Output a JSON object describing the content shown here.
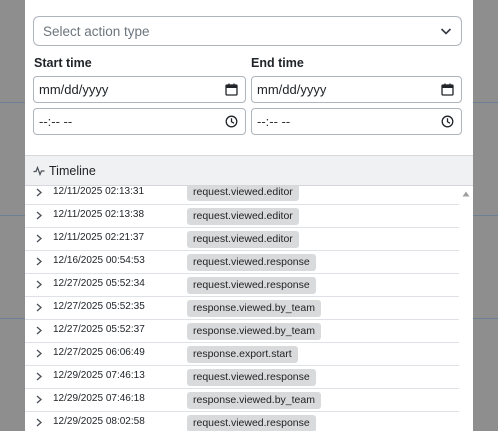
{
  "modal": {
    "action_select": {
      "placeholder": "Select action type"
    },
    "start_label": "Start time",
    "end_label": "End time",
    "start_date_placeholder": "mm/dd/yyyy",
    "end_date_placeholder": "mm/dd/yyyy",
    "start_time_placeholder": "--:-- --",
    "end_time_placeholder": "--:-- --",
    "timeline_title": "Timeline",
    "events": [
      {
        "time": "12/11/2025 02:13:31",
        "action": "request.viewed.editor"
      },
      {
        "time": "12/11/2025 02:13:38",
        "action": "request.viewed.editor"
      },
      {
        "time": "12/11/2025 02:21:37",
        "action": "request.viewed.editor"
      },
      {
        "time": "12/16/2025 00:54:53",
        "action": "request.viewed.response"
      },
      {
        "time": "12/27/2025 05:52:34",
        "action": "request.viewed.response"
      },
      {
        "time": "12/27/2025 05:52:35",
        "action": "response.viewed.by_team"
      },
      {
        "time": "12/27/2025 05:52:37",
        "action": "response.viewed.by_team"
      },
      {
        "time": "12/27/2025 06:06:49",
        "action": "response.export.start"
      },
      {
        "time": "12/29/2025 07:46:13",
        "action": "request.viewed.response"
      },
      {
        "time": "12/29/2025 07:46:18",
        "action": "response.viewed.by_team"
      },
      {
        "time": "12/29/2025 08:02:58",
        "action": "request.viewed.response"
      }
    ]
  },
  "icons": {
    "select_chevron": "chevron-down-icon",
    "date": "calendar-icon",
    "time": "clock-icon",
    "timeline": "activity-icon",
    "row_expand": "chevron-right-icon",
    "scroll_up": "scroll-up-arrow-icon"
  }
}
